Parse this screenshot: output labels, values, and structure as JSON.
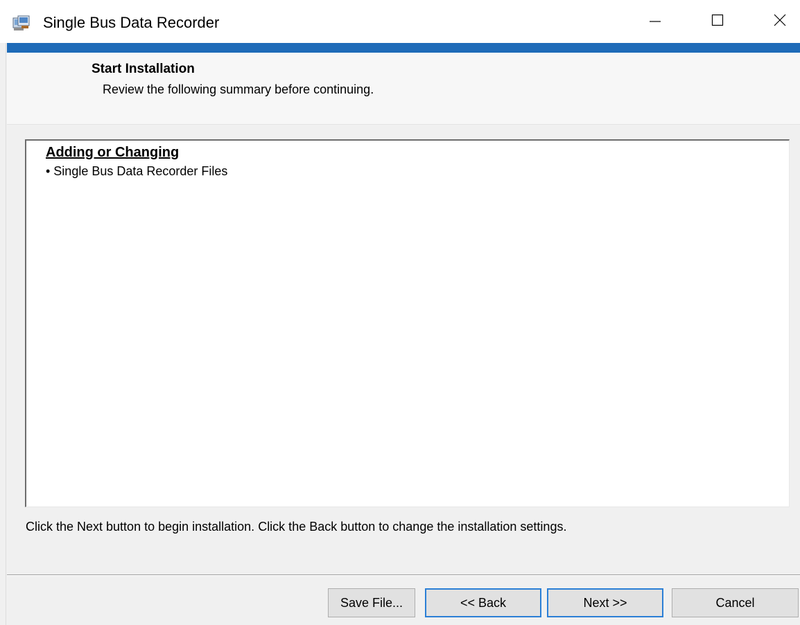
{
  "window": {
    "title": "Single Bus Data Recorder",
    "icon": "installer-icon",
    "accent_color": "#1e6bb8"
  },
  "header": {
    "title": "Start Installation",
    "subtitle": "Review the following summary before continuing."
  },
  "summary": {
    "heading": "Adding or Changing",
    "items": [
      "• Single Bus Data Recorder Files"
    ]
  },
  "instructions": "Click the Next button to begin installation.  Click the Back button to change the installation settings.",
  "buttons": {
    "save_file": "Save File...",
    "back": "<< Back",
    "next": "Next >>",
    "cancel": "Cancel"
  }
}
